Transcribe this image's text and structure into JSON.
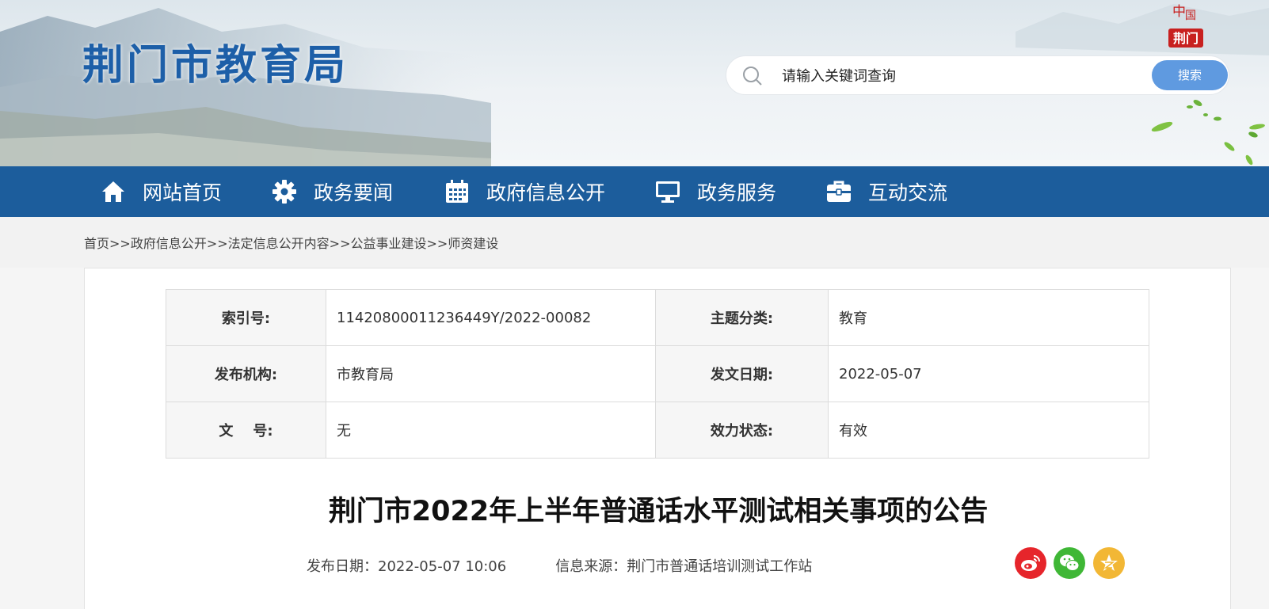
{
  "header": {
    "site_title": "荆门市教育局",
    "logo_text_top": "中国",
    "logo_text_bottom": "荆门",
    "search_placeholder": "请输入关键词查询",
    "search_button": "搜索"
  },
  "nav": {
    "items": [
      {
        "label": "网站首页",
        "icon": "home-icon"
      },
      {
        "label": "政务要闻",
        "icon": "gear-icon"
      },
      {
        "label": "政府信息公开",
        "icon": "calendar-icon"
      },
      {
        "label": "政务服务",
        "icon": "monitor-icon"
      },
      {
        "label": "互动交流",
        "icon": "briefcase-icon"
      }
    ]
  },
  "breadcrumb": [
    "首页",
    "政府信息公开",
    "法定信息公开内容",
    "公益事业建设",
    "师资建设"
  ],
  "breadcrumb_separator": ">>",
  "meta": {
    "index_label": "索引号:",
    "index_value": "11420800011236449Y/2022-00082",
    "topic_label": "主题分类:",
    "topic_value": "教育",
    "org_label": "发布机构:",
    "org_value": "市教育局",
    "date_label": "发文日期:",
    "date_value": "2022-05-07",
    "docno_label": "文    号:",
    "docno_value": "无",
    "status_label": "效力状态:",
    "status_value": "有效"
  },
  "article": {
    "title": "荆门市2022年上半年普通话水平测试相关事项的公告",
    "publish_date": "发布日期：2022-05-07 10:06",
    "source": "信息来源：荆门市普通话培训测试工作站"
  },
  "share": {
    "weibo_color": "#e6252b",
    "wechat_color": "#3fb736",
    "qzone_color": "#f2b735"
  },
  "colors": {
    "nav_bg": "#1c5d9c",
    "title_blue": "#1d5fa8",
    "search_btn": "#5f9ae0"
  }
}
